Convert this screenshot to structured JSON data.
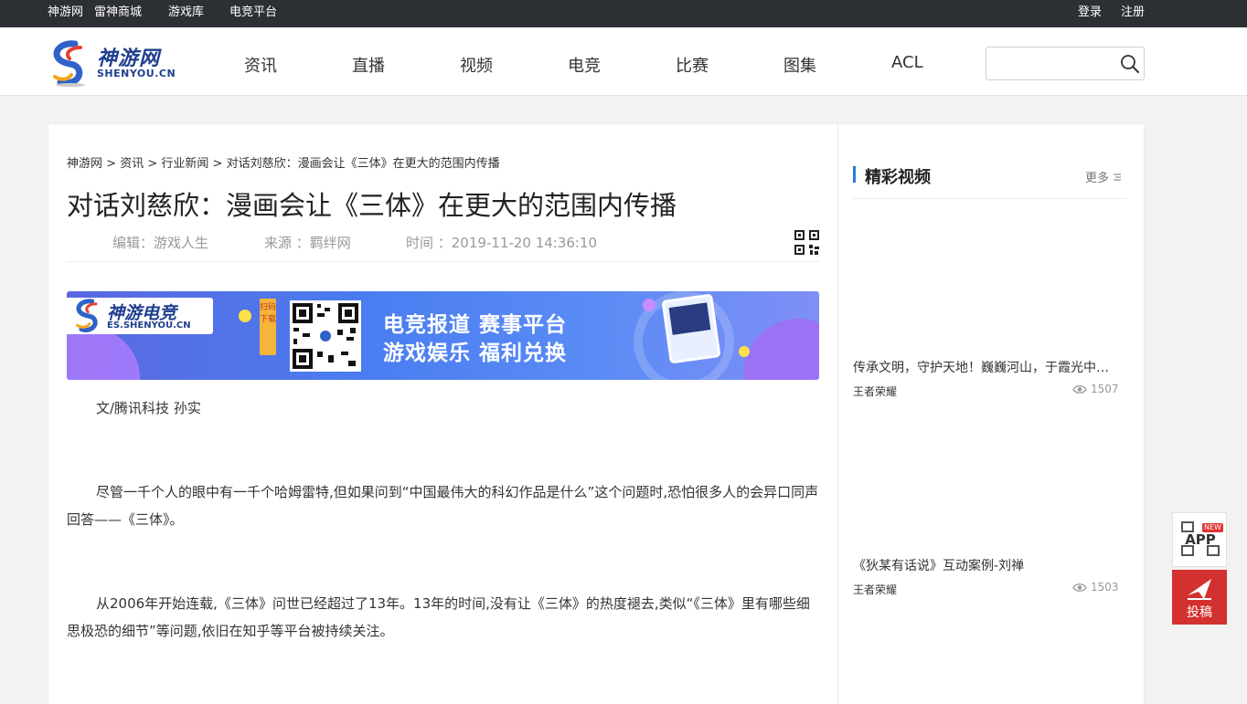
{
  "topbar": {
    "links": [
      "神游网",
      "雷神商城",
      "游戏库",
      "电竞平台"
    ],
    "login": "登录",
    "register": "注册"
  },
  "header": {
    "logo_cn": "神游网",
    "logo_en": "SHENYOU.CN",
    "nav": [
      "资讯",
      "直播",
      "视频",
      "电竞",
      "比赛",
      "图集",
      "ACL"
    ],
    "search": {
      "placeholder": "",
      "value": ""
    }
  },
  "article": {
    "breadcrumb": [
      "神游网",
      "资讯",
      "行业新闻",
      "对话刘慈欣：漫画会让《三体》在更大的范围内传播"
    ],
    "title": "对话刘慈欣：漫画会让《三体》在更大的范围内传播",
    "editor": "编辑：游戏人生",
    "source": "来源 ：羁绊网",
    "time": "时间 ：2019-11-20 14:36:10",
    "banner": {
      "logo_cn": "神游电竞",
      "logo_en": "ES.SHENYOU.CN",
      "scan": "扫码下载",
      "line1": "电竞报道 赛事平台",
      "line2": "游戏娱乐 福利兑换"
    },
    "paragraphs": [
      "文/腾讯科技 孙实",
      "尽管一千个人的眼中有一千个哈姆雷特,但如果问到“中国最伟大的科幻作品是什么”这个问题时,恐怕很多人的会异口同声回答——《三体》。",
      "从2006年开始连载,《三体》问世已经超过了13年。13年的时间,没有让《三体》的热度褪去,类似“《三体》里有哪些细思极恐的细节”等问题,依旧在知乎等平台被持续关注。"
    ]
  },
  "sidebar": {
    "title": "精彩视频",
    "more": "更多",
    "videos": [
      {
        "title": "传承文明，守护天地！巍巍河山，于霞光中…",
        "tag": "王者荣耀",
        "views": "1507"
      },
      {
        "title": "《狄某有话说》互动案例-刘禅",
        "tag": "王者荣耀",
        "views": "1503"
      }
    ]
  },
  "floating": {
    "app_label": "APP",
    "app_badge": "NEW",
    "post_label": "投稿"
  },
  "colors": {
    "topbar_bg": "#2c2f33",
    "accent_blue": "#2a7bd8",
    "post_red": "#d3312f"
  }
}
